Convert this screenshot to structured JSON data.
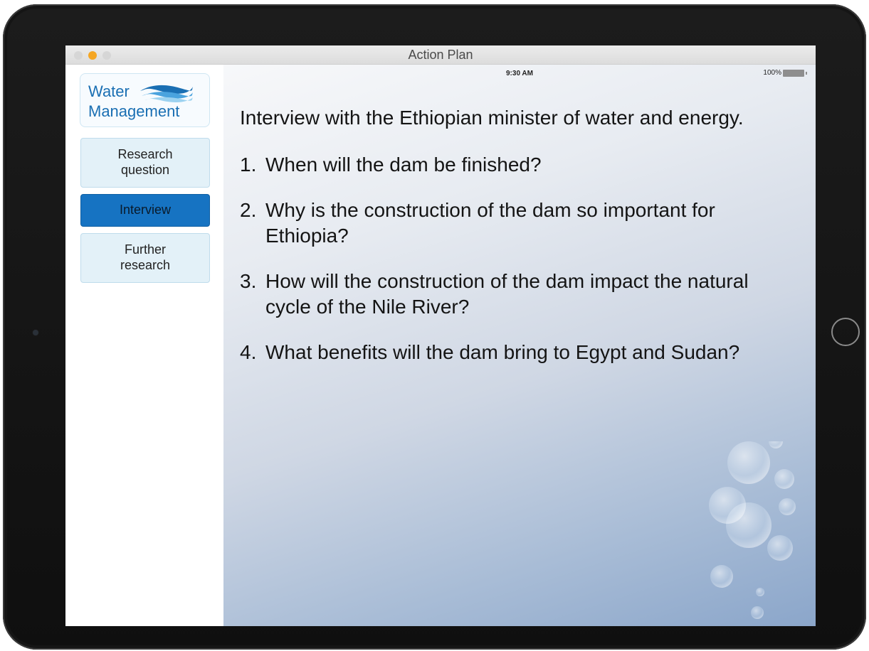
{
  "window": {
    "title": "Action Plan"
  },
  "status_bar": {
    "time": "9:30 AM",
    "battery": "100%"
  },
  "sidebar": {
    "logo": {
      "line1": "Water",
      "line2": "Management"
    },
    "items": [
      {
        "label_line1": "Research",
        "label_line2": "question",
        "active": false
      },
      {
        "label_line1": "Interview",
        "label_line2": "",
        "active": true
      },
      {
        "label_line1": "Further",
        "label_line2": "research",
        "active": false
      }
    ]
  },
  "main": {
    "intro": "Interview with the Ethiopian minister of water and energy.",
    "questions": [
      {
        "number": "1.",
        "text": "When will the dam be finished?"
      },
      {
        "number": "2.",
        "text": "Why is the construction of the dam so important for Ethiopia?"
      },
      {
        "number": "3.",
        "text": "How will the construction of the dam impact the natural cycle of the Nile River?"
      },
      {
        "number": "4.",
        "text": "What benefits will the dam bring to Egypt and Sudan?"
      }
    ]
  },
  "colors": {
    "accent": "#1673c2",
    "nav_item_bg": "#e3f1f8",
    "logo_text": "#1a6fb3",
    "traffic_light_active": "#f5a623"
  },
  "icons": {
    "logo_graphic": "water-waves-icon",
    "battery": "battery-icon",
    "home": "home-button-icon"
  }
}
